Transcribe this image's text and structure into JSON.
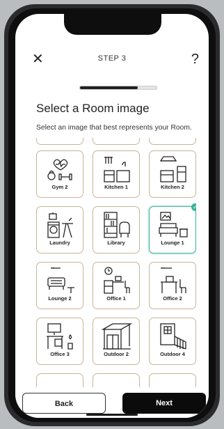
{
  "header": {
    "step_label": "STEP 3",
    "close_icon": "close-icon",
    "help_label": "?"
  },
  "progress": {
    "fraction": 0.75
  },
  "page": {
    "title": "Select a Room image",
    "subtitle": "Select an image that best represents your Room."
  },
  "tiles": [
    {
      "label": "Gym 2",
      "icon": "gym-icon",
      "selected": false
    },
    {
      "label": "Kitchen 1",
      "icon": "kitchen-icon",
      "selected": false
    },
    {
      "label": "Kitchen 2",
      "icon": "kitchen-icon",
      "selected": false
    },
    {
      "label": "Laundry",
      "icon": "laundry-icon",
      "selected": false
    },
    {
      "label": "Library",
      "icon": "library-icon",
      "selected": false
    },
    {
      "label": "Lounge 1",
      "icon": "lounge-icon",
      "selected": true
    },
    {
      "label": "Lounge 2",
      "icon": "lounge-icon",
      "selected": false
    },
    {
      "label": "Office 1",
      "icon": "office-icon",
      "selected": false
    },
    {
      "label": "Office 2",
      "icon": "office-icon",
      "selected": false
    },
    {
      "label": "Office 3",
      "icon": "office-icon",
      "selected": false
    },
    {
      "label": "Outdoor 2",
      "icon": "outdoor-icon",
      "selected": false
    },
    {
      "label": "Outdoor 4",
      "icon": "outdoor-icon",
      "selected": false
    }
  ],
  "footer": {
    "back_label": "Back",
    "next_label": "Next"
  },
  "colors": {
    "accent": "#3bb49a",
    "tile_border": "#c8b49a",
    "primary_button": "#0b0b0b"
  }
}
